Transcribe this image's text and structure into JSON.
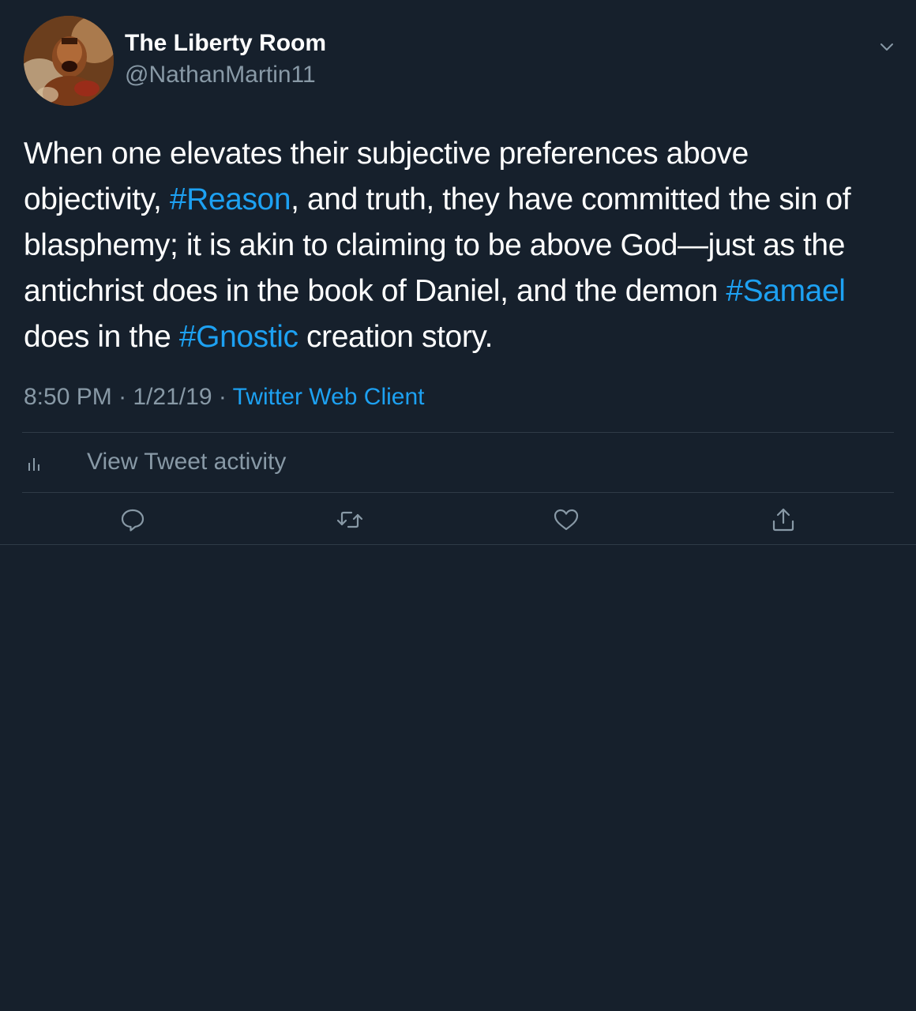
{
  "tweet": {
    "display_name": "The Liberty Room",
    "handle": "@NathanMartin11",
    "text_segments": [
      {
        "text": "When one elevates their subjective preferences above objectivity, ",
        "hashtag": false
      },
      {
        "text": "#Reason",
        "hashtag": true
      },
      {
        "text": ", and truth, they have committed the sin of blasphemy; it is akin to claiming to be above God—just as the antichrist does in the book of Daniel, and the demon ",
        "hashtag": false
      },
      {
        "text": "#Samael",
        "hashtag": true
      },
      {
        "text": " does in the ",
        "hashtag": false
      },
      {
        "text": "#Gnostic",
        "hashtag": true
      },
      {
        "text": " creation story.",
        "hashtag": false
      }
    ],
    "time": "8:50 PM",
    "date": "1/21/19",
    "separator": " · ",
    "source": "Twitter Web Client"
  },
  "activity": {
    "label": "View Tweet activity",
    "icon": "bar-chart-icon"
  },
  "actions": [
    {
      "name": "reply",
      "icon": "reply-icon"
    },
    {
      "name": "retweet",
      "icon": "retweet-icon"
    },
    {
      "name": "like",
      "icon": "heart-icon"
    },
    {
      "name": "share",
      "icon": "share-icon"
    }
  ],
  "colors": {
    "background": "#16202c",
    "text": "#ffffff",
    "secondary": "#8899a6",
    "accent": "#1da1f2",
    "divider": "#2f3b47"
  }
}
